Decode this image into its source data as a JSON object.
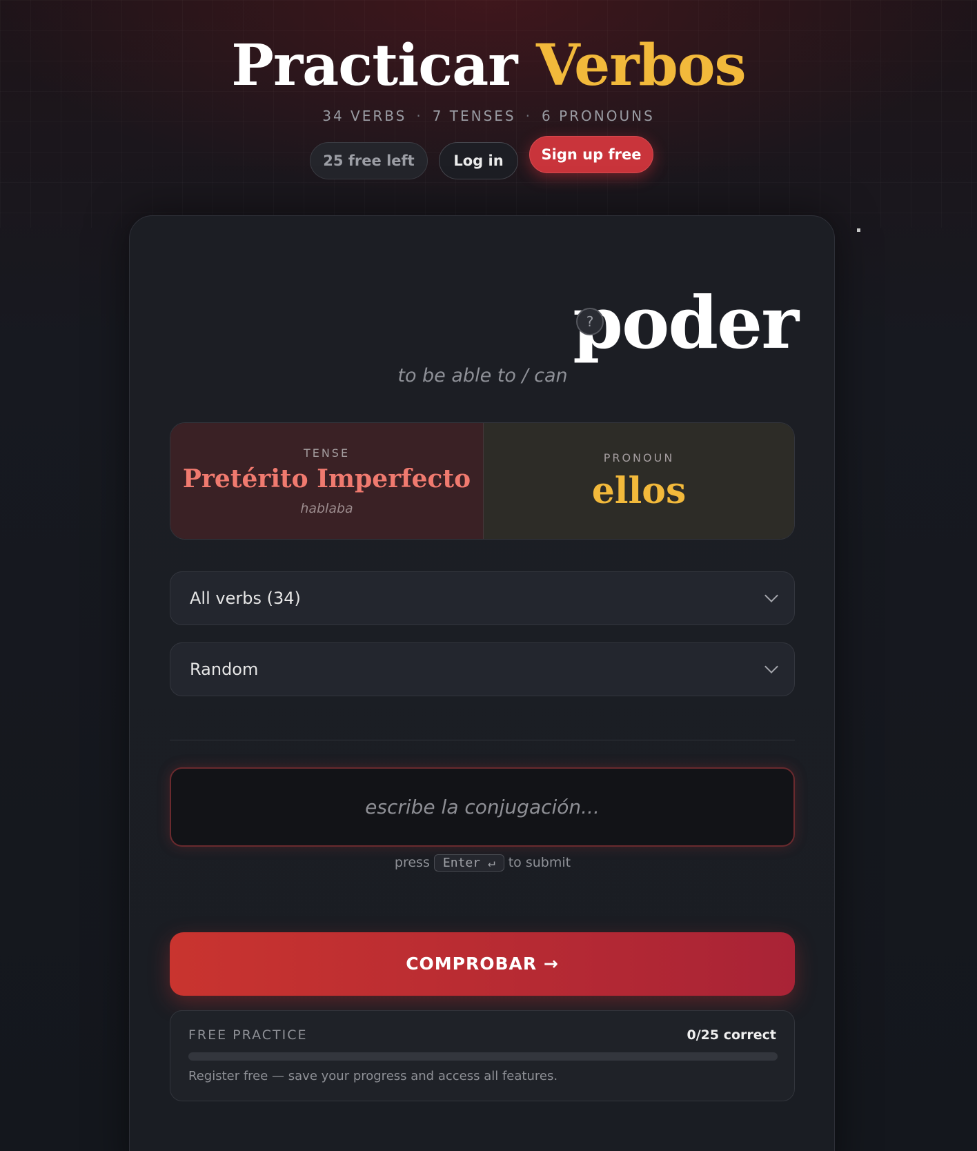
{
  "header": {
    "title_main": "Practicar ",
    "title_accent": "Verbos",
    "stats": [
      "34 VERBS",
      "7 TENSES",
      "6 PRONOUNS"
    ],
    "stats_separator": "·",
    "free_left": "25 free left",
    "login": "Log in",
    "signup": "Sign up free"
  },
  "card": {
    "verb": "poder",
    "help_glyph": "?",
    "meaning": "to be able to / can",
    "tense": {
      "label": "TENSE",
      "name": "Pretérito Imperfecto",
      "example": "hablaba"
    },
    "pronoun": {
      "label": "PRONOUN",
      "name": "ellos"
    },
    "verb_select": {
      "selected": "All verbs (34)"
    },
    "order_select": {
      "selected": "Random"
    },
    "answer": {
      "value": "",
      "placeholder": "escribe la conjugación..."
    },
    "hint": {
      "before": "press",
      "key": "Enter ↵",
      "after": "to submit"
    },
    "submit": "COMPROBAR →",
    "progress": {
      "label": "FREE PRACTICE",
      "count": "0/25 correct",
      "correct": 0,
      "total": 25,
      "note": "Register free — save your progress and access all features."
    }
  },
  "colors": {
    "accent_gold": "#f2b93b",
    "accent_red": "#c9343b",
    "tense_text": "#f07a6f"
  }
}
